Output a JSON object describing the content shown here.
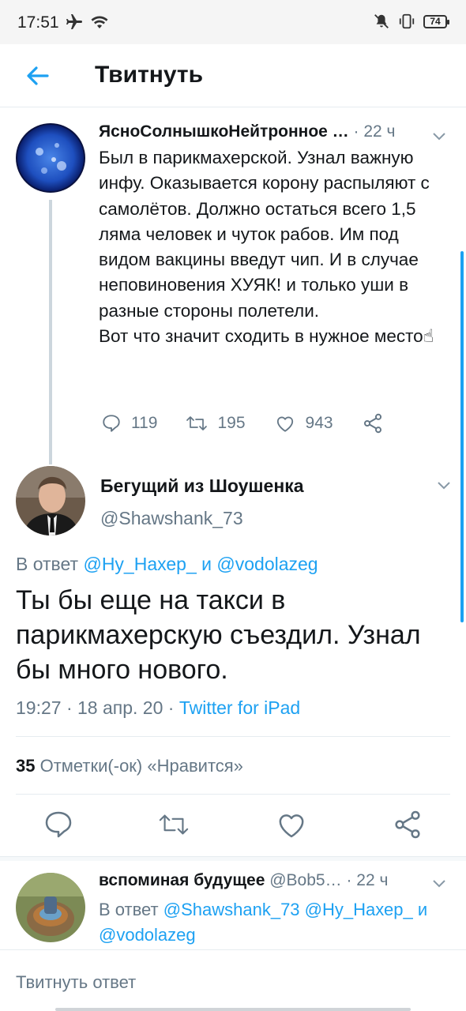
{
  "status_bar": {
    "time": "17:51",
    "battery": "74"
  },
  "header": {
    "title": "Твитнуть"
  },
  "tweets": [
    {
      "name": "ЯсноСолнышкоНейтронное …",
      "time": "· 22 ч",
      "paragraphs": [
        "Был в парикмахерской. Узнал важную инфу. Оказывается корону распыляют с самолётов. Должно остаться всего 1,5 ляма человек и чуток рабов. Им под видом вакцины введут чип. И в случае неповиновения ХУЯК! и только уши в разные стороны полетели.",
        "Вот что значит сходить в нужное место☝"
      ],
      "replies": "119",
      "retweets": "195",
      "likes": "943"
    }
  ],
  "main_tweet": {
    "name": "Бегущий из Шоушенка",
    "handle": "@Shawshank_73",
    "reply_prefix": "В ответ",
    "reply_user1": "@Ну_Нахер_",
    "reply_and": "и",
    "reply_user2": "@vodolazeg",
    "text": "Ты бы еще на такси в парикмахерскую съездил. Узнал бы много нового.",
    "time_date": "19:27 · 18 апр. 20 ·",
    "source": "Twitter for iPad",
    "likes_count": "35",
    "likes_label": "Отметки(-ок) «Нравится»"
  },
  "reply_tweet": {
    "name": "вспоминая будущее",
    "handle": "@Bob5…",
    "time": "· 22 ч",
    "reply_prefix": "В ответ",
    "reply_user1": "@Shawshank_73",
    "reply_user2": "@Ну_Нахер_",
    "reply_and": "и",
    "reply_user3": "@vodolazeg"
  },
  "composer": {
    "placeholder": "Твитнуть ответ"
  },
  "colors": {
    "accent": "#1da1f2",
    "secondary_text": "#657786",
    "primary_text": "#14171a"
  }
}
